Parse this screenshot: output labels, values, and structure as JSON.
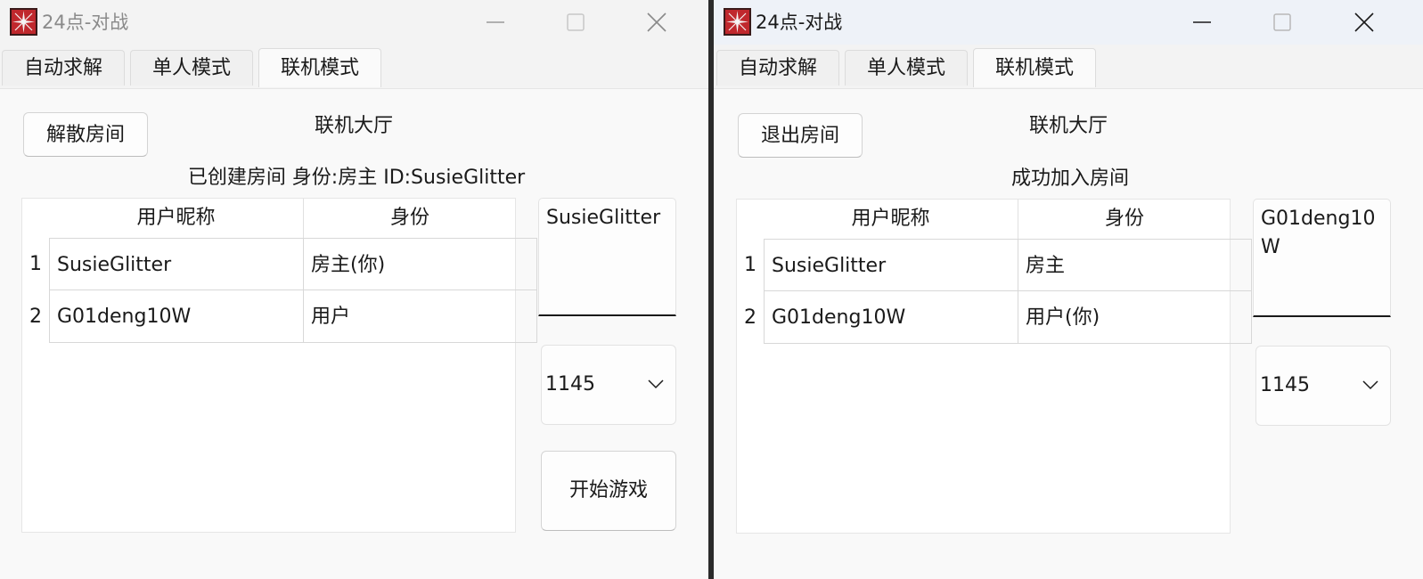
{
  "left_window": {
    "title": "24点-对战",
    "tabs": [
      {
        "label": "自动求解"
      },
      {
        "label": "单人模式"
      },
      {
        "label": "联机模式"
      }
    ],
    "room_button": "解散房间",
    "lobby_title": "联机大厅",
    "status": "已创建房间 身份:房主 ID:SusieGlitter",
    "table": {
      "headers": [
        "用户昵称",
        "身份"
      ],
      "rows": [
        {
          "num": "1",
          "nickname": "SusieGlitter",
          "role": "房主(你)"
        },
        {
          "num": "2",
          "nickname": "G01deng10W",
          "role": "用户"
        }
      ]
    },
    "name_input": "SusieGlitter",
    "number_select": "1145",
    "start_button": "开始游戏"
  },
  "right_window": {
    "title": "24点-对战",
    "tabs": [
      {
        "label": "自动求解"
      },
      {
        "label": "单人模式"
      },
      {
        "label": "联机模式"
      }
    ],
    "room_button": "退出房间",
    "lobby_title": "联机大厅",
    "status": "成功加入房间",
    "table": {
      "headers": [
        "用户昵称",
        "身份"
      ],
      "rows": [
        {
          "num": "1",
          "nickname": "SusieGlitter",
          "role": "房主"
        },
        {
          "num": "2",
          "nickname": "G01deng10W",
          "role": "用户(你)"
        }
      ]
    },
    "name_input": "G01deng10W",
    "number_select": "1145"
  },
  "colors": {
    "icon_red": "#c0282d",
    "icon_dark": "#3a1a1a",
    "window_bg": "#f3f3f3",
    "content_bg": "#f9f9f9",
    "table_bg": "#ffffff"
  }
}
